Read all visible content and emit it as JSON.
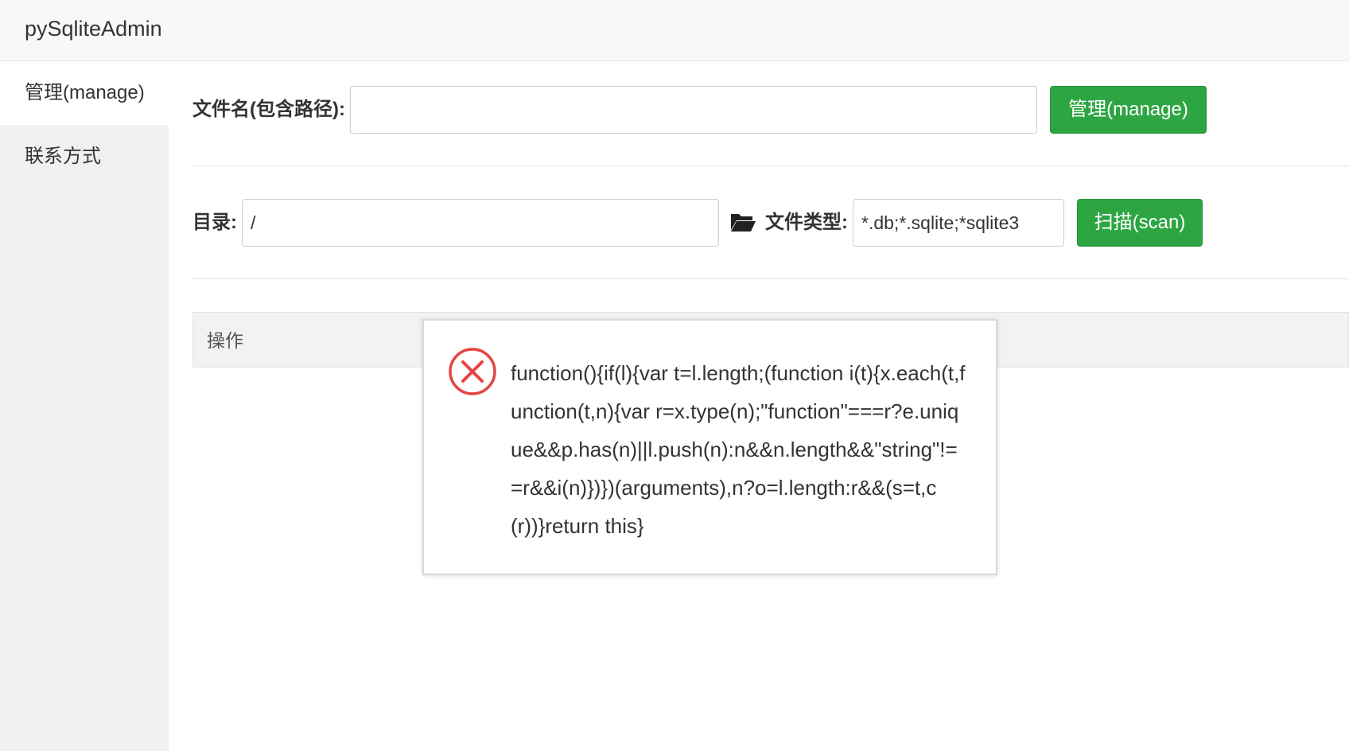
{
  "app": {
    "title": "pySqliteAdmin"
  },
  "sidebar": {
    "items": [
      {
        "label": "管理(manage)",
        "active": true
      },
      {
        "label": "联系方式",
        "active": false
      }
    ]
  },
  "manage_form": {
    "filename_label": "文件名(包含路径):",
    "filename_value": "",
    "manage_button": "管理(manage)"
  },
  "scan_form": {
    "dir_label": "目录:",
    "dir_value": "/",
    "filetype_label": "文件类型:",
    "filetype_value": "*.db;*.sqlite;*sqlite3",
    "scan_button": "扫描(scan)"
  },
  "table": {
    "columns": [
      "操作"
    ]
  },
  "dialog": {
    "icon": "error-circle-icon",
    "message": "function(){if(l){var t=l.length;(function i(t){x.each(t,function(t,n){var r=x.type(n);\"function\"===r?e.unique&&p.has(n)||l.push(n):n&&n.length&&\"string\"!==r&&i(n)})})(arguments),n?o=l.length:r&&(s=t,c(r))}return this}"
  },
  "colors": {
    "button_green": "#2ea543",
    "header_bg": "#f8f8f8",
    "sidebar_bg": "#f0f0f0",
    "error_red": "#e64340"
  }
}
